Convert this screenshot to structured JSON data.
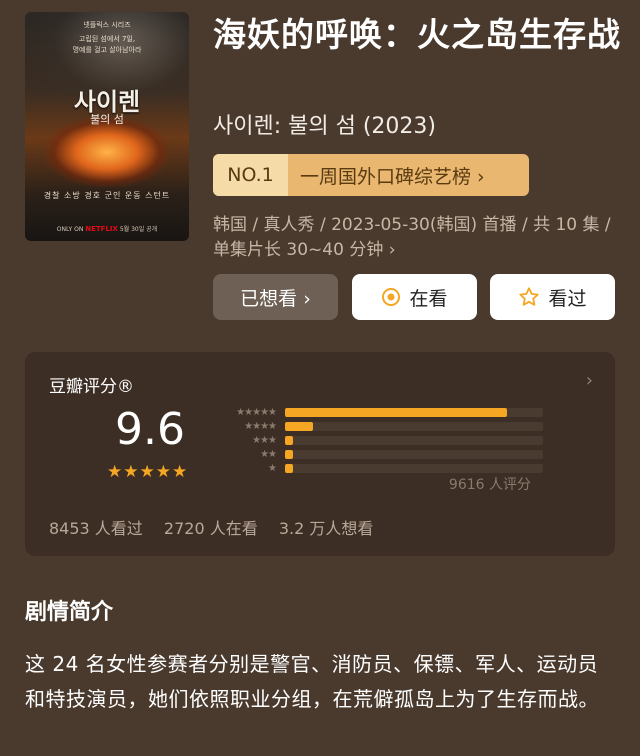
{
  "poster": {
    "tagline_line1": "고립된 섬에서 7일,",
    "tagline_line2": "명예를 걸고 살아남아라",
    "presenter": "넷플릭스 시리즈",
    "ko_title": "사이렌",
    "ko_subtitle": "불의 섬",
    "names": "경찰 소방 경호 군인 운동 스턴트",
    "footer_only_on": "ONLY ON",
    "footer_brand": "NETFLIX",
    "footer_date": "5월 30일 공개"
  },
  "title": "海妖的呼唤：火之岛生存战",
  "original_title": "사이렌: 불의 섬 (2023)",
  "rank": {
    "number": "NO.1",
    "label": "一周国外口碑综艺榜 ›"
  },
  "meta": "韩国 / 真人秀 / 2023-05-30(韩国) 首播 / 共 10 集 / 单集片长 30~40 分钟 ›",
  "buttons": {
    "want": "已想看 ›",
    "watching": "在看",
    "watched": "看过"
  },
  "rating": {
    "heading": "豆瓣评分®",
    "score": "9.6",
    "stars": "★★★★★",
    "distribution": [
      {
        "stars": "★★★★★",
        "percent": 0.86
      },
      {
        "stars": "★★★★",
        "percent": 0.11
      },
      {
        "stars": "★★★",
        "percent": 0.02
      },
      {
        "stars": "★★",
        "percent": 0.01
      },
      {
        "stars": "★",
        "percent": 0.01
      }
    ],
    "count": "9616 人评分",
    "watched_stat": "8453 人看过",
    "watching_stat": "2720 人在看",
    "want_stat": "3.2 万人想看"
  },
  "synopsis": {
    "heading": "剧情简介",
    "text": "这 24 名女性参赛者分别是警官、消防员、保镖、军人、运动员和特技演员，她们依照职业分组，在荒僻孤岛上为了生存而战。"
  },
  "colors": {
    "background": "#4a3a2e",
    "card": "#3c2e24",
    "accent": "#f5a623",
    "badge": "#e9b770"
  }
}
